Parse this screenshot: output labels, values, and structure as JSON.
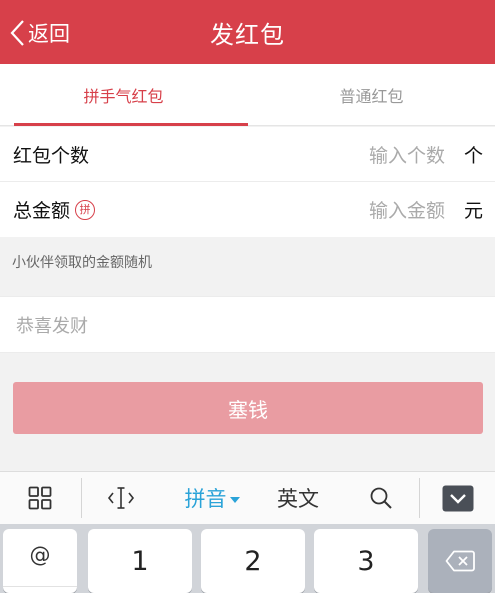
{
  "header": {
    "back_label": "返回",
    "title": "发红包",
    "color": "#d7404a"
  },
  "tabs": [
    {
      "label": "拼手气红包",
      "active": true
    },
    {
      "label": "普通红包",
      "active": false
    }
  ],
  "form": {
    "count": {
      "label": "红包个数",
      "placeholder": "输入个数",
      "unit": "个"
    },
    "amount": {
      "label": "总金额",
      "badge": "拼",
      "placeholder": "输入金额",
      "unit": "元"
    },
    "hint": "小伙伴领取的金额随机"
  },
  "greeting": {
    "placeholder": "恭喜发财"
  },
  "send_button": {
    "label": "塞钱",
    "color": "#e99ca2"
  },
  "keyboard_toolbar": {
    "items": [
      {
        "icon": "grid-icon"
      },
      {
        "icon": "cursor-move-icon"
      },
      {
        "label": "拼音",
        "active": true,
        "has_dropdown": true
      },
      {
        "label": "英文"
      },
      {
        "icon": "search-icon"
      },
      {
        "icon": "hide-keyboard-icon"
      }
    ],
    "pinyin_label": "拼音",
    "english_label": "英文"
  },
  "keyboard": {
    "symbol_key": "@",
    "keys": [
      "1",
      "2",
      "3"
    ],
    "delete_icon": "backspace-icon"
  }
}
